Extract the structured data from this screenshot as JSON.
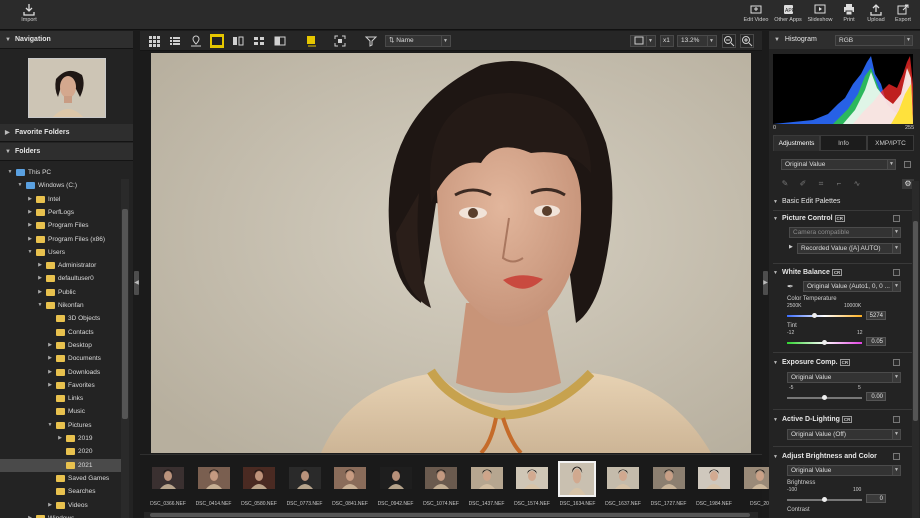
{
  "toolbar": {
    "import": "Import",
    "edit_video": "Edit Video",
    "other_apps": "Other Apps",
    "slideshow": "Slideshow",
    "print": "Print",
    "upload": "Upload",
    "export": "Export"
  },
  "left": {
    "navigation": "Navigation",
    "favorite_folders": "Favorite Folders",
    "folders": "Folders",
    "tree": [
      {
        "label": "This PC",
        "depth": 0,
        "exp": "▼",
        "icon": "pc"
      },
      {
        "label": "Windows (C:)",
        "depth": 1,
        "exp": "▼",
        "icon": "drive"
      },
      {
        "label": "Intel",
        "depth": 2,
        "exp": "▶",
        "icon": "folder"
      },
      {
        "label": "PerfLogs",
        "depth": 2,
        "exp": "▶",
        "icon": "folder"
      },
      {
        "label": "Program Files",
        "depth": 2,
        "exp": "▶",
        "icon": "folder"
      },
      {
        "label": "Program Files (x86)",
        "depth": 2,
        "exp": "▶",
        "icon": "folder"
      },
      {
        "label": "Users",
        "depth": 2,
        "exp": "▼",
        "icon": "folder"
      },
      {
        "label": "Administrator",
        "depth": 3,
        "exp": "▶",
        "icon": "folder"
      },
      {
        "label": "defaultuser0",
        "depth": 3,
        "exp": "▶",
        "icon": "folder"
      },
      {
        "label": "Public",
        "depth": 3,
        "exp": "▶",
        "icon": "folder"
      },
      {
        "label": "Nikonfan",
        "depth": 3,
        "exp": "▼",
        "icon": "folder"
      },
      {
        "label": "3D Objects",
        "depth": 4,
        "exp": "",
        "icon": "folder"
      },
      {
        "label": "Contacts",
        "depth": 4,
        "exp": "",
        "icon": "folder"
      },
      {
        "label": "Desktop",
        "depth": 4,
        "exp": "▶",
        "icon": "folder"
      },
      {
        "label": "Documents",
        "depth": 4,
        "exp": "▶",
        "icon": "folder"
      },
      {
        "label": "Downloads",
        "depth": 4,
        "exp": "▶",
        "icon": "folder"
      },
      {
        "label": "Favorites",
        "depth": 4,
        "exp": "▶",
        "icon": "folder"
      },
      {
        "label": "Links",
        "depth": 4,
        "exp": "",
        "icon": "folder"
      },
      {
        "label": "Music",
        "depth": 4,
        "exp": "",
        "icon": "folder"
      },
      {
        "label": "Pictures",
        "depth": 4,
        "exp": "▼",
        "icon": "folder"
      },
      {
        "label": "2019",
        "depth": 5,
        "exp": "▶",
        "icon": "folder"
      },
      {
        "label": "2020",
        "depth": 5,
        "exp": "",
        "icon": "folder"
      },
      {
        "label": "2021",
        "depth": 5,
        "exp": "",
        "icon": "folder",
        "selected": true
      },
      {
        "label": "Saved Games",
        "depth": 4,
        "exp": "",
        "icon": "folder"
      },
      {
        "label": "Searches",
        "depth": 4,
        "exp": "",
        "icon": "folder"
      },
      {
        "label": "Videos",
        "depth": 4,
        "exp": "▶",
        "icon": "folder"
      },
      {
        "label": "Windows",
        "depth": 2,
        "exp": "▶",
        "icon": "folder"
      }
    ]
  },
  "center": {
    "sort": "Name",
    "scale_label": "x1",
    "zoom": "13.2%",
    "filmstrip": [
      {
        "name": "DSC_0366.NEF",
        "tone": "#3a3030"
      },
      {
        "name": "DSC_0414.NEF",
        "tone": "#7a5f50"
      },
      {
        "name": "DSC_0580.NEF",
        "tone": "#4a2a22"
      },
      {
        "name": "DSC_0773.NEF",
        "tone": "#2a2a2a"
      },
      {
        "name": "DSC_0841.NEF",
        "tone": "#8a6c5a"
      },
      {
        "name": "DSC_0942.NEF",
        "tone": "#1e1e1e"
      },
      {
        "name": "DSC_1074.NEF",
        "tone": "#6a5a4e"
      },
      {
        "name": "DSC_1437.NEF",
        "tone": "#b6a690"
      },
      {
        "name": "DSC_1574.NEF",
        "tone": "#cfc6b6"
      },
      {
        "name": "DSC_1634.NEF",
        "tone": "#c9c0b0",
        "selected": true
      },
      {
        "name": "DSC_1637.NEF",
        "tone": "#c4bbab"
      },
      {
        "name": "DSC_1727.NEF",
        "tone": "#8c7f70"
      },
      {
        "name": "DSC_1984.NEF",
        "tone": "#cfc8bd"
      },
      {
        "name": "DSC_20",
        "tone": "#9a8a78"
      }
    ]
  },
  "right": {
    "histogram": "Histogram",
    "channel": "RGB",
    "hist_min": "0",
    "hist_max": "255",
    "tabs": [
      "Adjustments",
      "Info",
      "XMP/IPTC"
    ],
    "preset": "Original Value",
    "basic_edit": "Basic Edit Palettes",
    "picture_control": {
      "title": "Picture Control",
      "compat": "Camera compatible",
      "value": "Recorded Value ([A] AUTO)"
    },
    "white_balance": {
      "title": "White Balance",
      "value": "Original Value (Auto1, 0, 0 ...",
      "temp_label": "Color Temperature",
      "temp_min": "2500K",
      "temp_max": "10000K",
      "temp_value": "5274",
      "tint_label": "Tint",
      "tint_min": "-12",
      "tint_max": "12",
      "tint_value": "0.05"
    },
    "exposure": {
      "title": "Exposure Comp.",
      "value": "Original Value",
      "min": "-5",
      "max": "5",
      "number": "0.00"
    },
    "d_lighting": {
      "title": "Active D-Lighting",
      "value": "Original Value (Off)"
    },
    "brightness_color": {
      "title": "Adjust Brightness and Color",
      "value": "Original Value",
      "brightness": "Brightness",
      "b_min": "-100",
      "b_max": "100",
      "b_value": "0",
      "contrast": "Contrast"
    }
  }
}
